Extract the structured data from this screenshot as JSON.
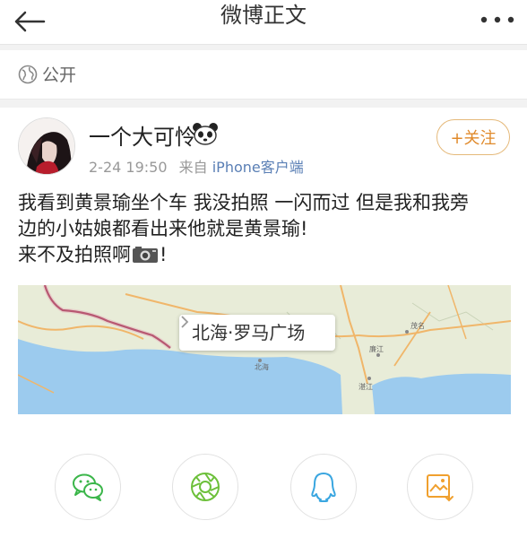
{
  "nav": {
    "title": "微博正文",
    "back_icon": "back-arrow-icon",
    "more_icon": "more-dots-icon"
  },
  "visibility": {
    "label": "公开",
    "icon": "globe-icon"
  },
  "author": {
    "name": "一个大可怜",
    "emoji_icon": "panda-icon",
    "time": "2-24 19:50",
    "from_prefix": "来自",
    "source": "iPhone客户端",
    "follow_label": "+关注"
  },
  "post": {
    "line1": "我看到黄景瑜坐个车 我没拍照 一闪而过 但是我和我旁",
    "line2": "边的小姑娘都看出来他就是黄景瑜!",
    "line3a": "来不及拍照啊",
    "line3b": "!",
    "inline_icon": "camera-icon"
  },
  "location": {
    "label": "北海·罗马广场",
    "arrow_icon": "chevron-right-icon"
  },
  "map_labels": {
    "beihai": "北海",
    "lianjiang": "廉江",
    "maoming": "茂名",
    "zhanjiang": "湛江"
  },
  "share": [
    {
      "name": "wechat",
      "icon": "wechat-icon",
      "color": "#3bb64a"
    },
    {
      "name": "moments",
      "icon": "moments-icon",
      "color": "#6cc03a"
    },
    {
      "name": "qq",
      "icon": "qq-icon",
      "color": "#3aa6e0"
    },
    {
      "name": "save-image",
      "icon": "save-image-icon",
      "color": "#f0a02e"
    }
  ],
  "colors": {
    "accent": "#e08a2b",
    "link": "#5a7fb5",
    "sea": "#9ccbee"
  }
}
